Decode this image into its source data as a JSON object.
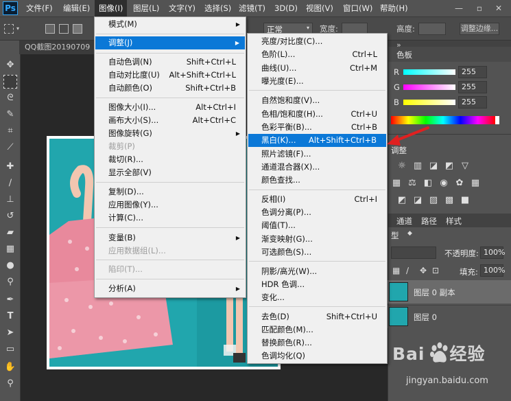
{
  "app": {
    "logo": "Ps"
  },
  "menubar": {
    "items": [
      "文件(F)",
      "编辑(E)",
      "图像(I)",
      "图层(L)",
      "文字(Y)",
      "选择(S)",
      "滤镜(T)",
      "3D(D)",
      "视图(V)",
      "窗口(W)",
      "帮助(H)"
    ],
    "active": "图像(I)"
  },
  "optionsbar": {
    "mode_value": "正常",
    "width_label": "宽度:",
    "height_label": "高度:",
    "adjust_edge_label": "调整边缘..."
  },
  "document": {
    "tab_title": "QQ截图20190709"
  },
  "image_menu": {
    "items": [
      {
        "label": "模式(M)",
        "submenu": true
      },
      {
        "label": "调整(J)",
        "submenu": true,
        "highlighted": true
      },
      {
        "label": "自动色调(N)",
        "shortcut": "Shift+Ctrl+L"
      },
      {
        "label": "自动对比度(U)",
        "shortcut": "Alt+Shift+Ctrl+L"
      },
      {
        "label": "自动颜色(O)",
        "shortcut": "Shift+Ctrl+B"
      },
      {
        "label": "图像大小(I)...",
        "shortcut": "Alt+Ctrl+I"
      },
      {
        "label": "画布大小(S)...",
        "shortcut": "Alt+Ctrl+C"
      },
      {
        "label": "图像旋转(G)",
        "submenu": true
      },
      {
        "label": "裁剪(P)",
        "disabled": true
      },
      {
        "label": "裁切(R)..."
      },
      {
        "label": "显示全部(V)"
      },
      {
        "label": "复制(D)..."
      },
      {
        "label": "应用图像(Y)..."
      },
      {
        "label": "计算(C)..."
      },
      {
        "label": "变量(B)",
        "submenu": true
      },
      {
        "label": "应用数据组(L)...",
        "disabled": true
      },
      {
        "label": "陷印(T)...",
        "disabled": true
      },
      {
        "label": "分析(A)",
        "submenu": true
      }
    ]
  },
  "adjust_menu": {
    "items": [
      {
        "label": "亮度/对比度(C)..."
      },
      {
        "label": "色阶(L)...",
        "shortcut": "Ctrl+L"
      },
      {
        "label": "曲线(U)...",
        "shortcut": "Ctrl+M"
      },
      {
        "label": "曝光度(E)..."
      },
      {
        "label": "自然饱和度(V)..."
      },
      {
        "label": "色相/饱和度(H)...",
        "shortcut": "Ctrl+U"
      },
      {
        "label": "色彩平衡(B)...",
        "shortcut": "Ctrl+B"
      },
      {
        "label": "黑白(K)...",
        "shortcut": "Alt+Shift+Ctrl+B",
        "highlighted": true
      },
      {
        "label": "照片滤镜(F)..."
      },
      {
        "label": "通道混合器(X)..."
      },
      {
        "label": "颜色查找..."
      },
      {
        "label": "反相(I)",
        "shortcut": "Ctrl+I"
      },
      {
        "label": "色调分离(P)..."
      },
      {
        "label": "阈值(T)..."
      },
      {
        "label": "渐变映射(G)..."
      },
      {
        "label": "可选颜色(S)..."
      },
      {
        "label": "阴影/高光(W)..."
      },
      {
        "label": "HDR 色调..."
      },
      {
        "label": "变化..."
      },
      {
        "label": "去色(D)",
        "shortcut": "Shift+Ctrl+U"
      },
      {
        "label": "匹配颜色(M)..."
      },
      {
        "label": "替换颜色(R)..."
      },
      {
        "label": "色调均化(Q)"
      }
    ]
  },
  "color_panel": {
    "tab": "色板",
    "channels": [
      {
        "label": "R",
        "value": "255",
        "color": "#ff0000"
      },
      {
        "label": "G",
        "value": "255",
        "color": "#ff00ff"
      },
      {
        "label": "B",
        "value": "255",
        "color": "#ffff00"
      }
    ]
  },
  "adjustments_panel": {
    "title": "调整"
  },
  "layers_panel": {
    "tabs": [
      "通道",
      "路径",
      "样式"
    ],
    "kind_label": "型",
    "opacity_label": "不透明度:",
    "opacity_value": "100%",
    "fill_label": "填充:",
    "fill_value": "100%",
    "layers": [
      {
        "name": "图层 0 副本",
        "selected": true
      },
      {
        "name": "图层 0",
        "selected": false
      }
    ]
  },
  "watermark": {
    "brand": "Bai",
    "brand2": "经验",
    "sub": "jingyan.baidu.com"
  },
  "colors": {
    "highlight": "#0b78d7",
    "teal": "#21a6ad",
    "arrow": "#e02020"
  }
}
